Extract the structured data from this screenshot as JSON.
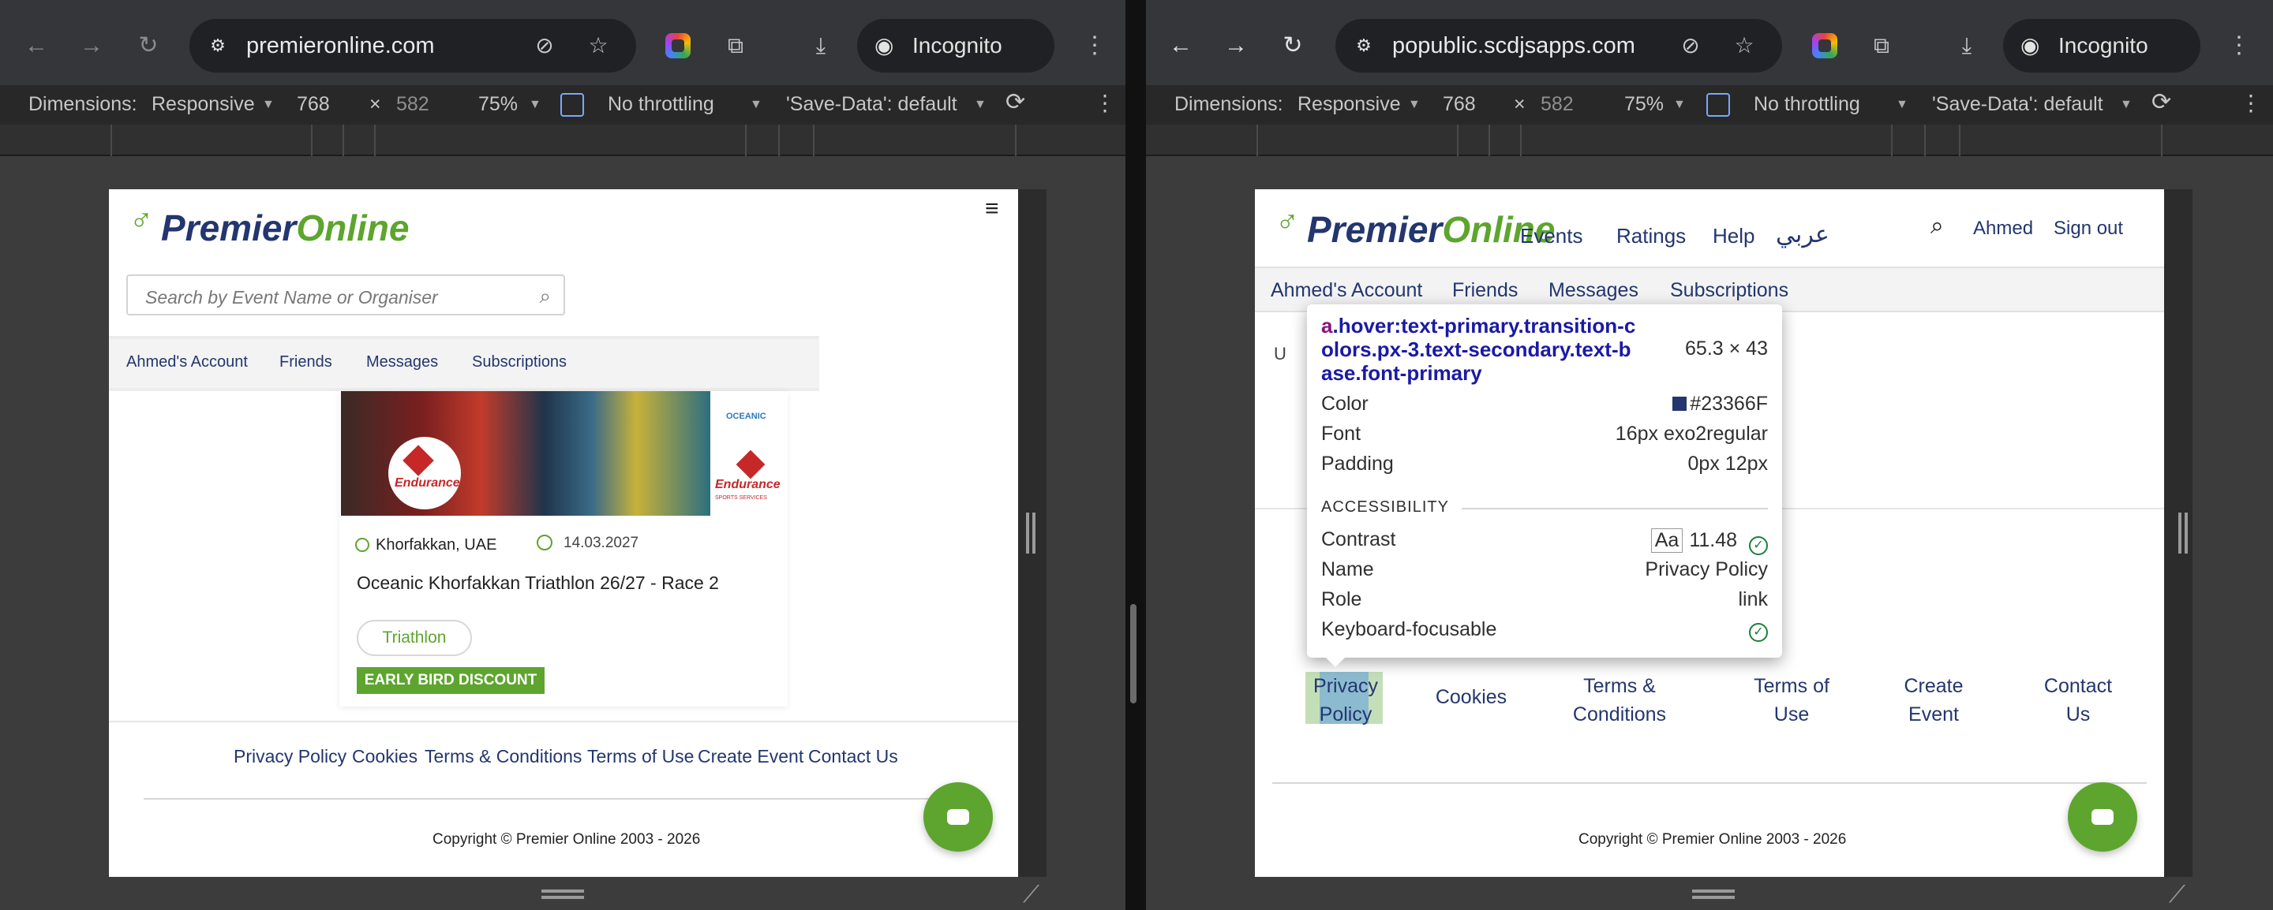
{
  "left": {
    "toolbar": {
      "url": "premieronline.com",
      "incognito": "Incognito (2)"
    },
    "devbar": {
      "dimensions_label": "Dimensions:",
      "mode": "Responsive",
      "width": "768",
      "times": "×",
      "height": "582",
      "zoom": "75%",
      "throttling": "No throttling",
      "save_data": "'Save-Data': default"
    },
    "site": {
      "logo_premier": "Premier",
      "logo_online": "Online",
      "search_placeholder": "Search by Event Name or Organiser",
      "subnav": [
        "Ahmed's Account",
        "Friends",
        "Messages",
        "Subscriptions"
      ],
      "event": {
        "location": "Khorfakkan, UAE",
        "date": "14.03.2027",
        "title": "Oceanic Khorfakkan Triathlon 26/27 - Race 2",
        "sport": "Triathlon",
        "badge": "EARLY BIRD DISCOUNT",
        "logo_text": "Endurance",
        "logo_sub": "SPORTS SERVICES",
        "oceanic": "OCEANIC"
      },
      "footer_links": [
        "Privacy Policy",
        "Cookies",
        "Terms & Conditions",
        "Terms of Use",
        "Create Event",
        "Contact Us"
      ],
      "copyright": "Copyright © Premier Online 2003 - 2026"
    }
  },
  "right": {
    "toolbar": {
      "url": "popublic.scdjsapps.com",
      "incognito": "Incognito (2)"
    },
    "devbar": {
      "dimensions_label": "Dimensions:",
      "mode": "Responsive",
      "width": "768",
      "times": "×",
      "height": "582",
      "zoom": "75%",
      "throttling": "No throttling",
      "save_data": "'Save-Data': default"
    },
    "site": {
      "logo_premier": "Premier",
      "logo_online": "Online",
      "nav": [
        "Events",
        "Ratings",
        "Help"
      ],
      "arabic": "عربي",
      "user": "Ahmed",
      "signout": "Sign out",
      "subnav": [
        "Ahmed's Account",
        "Friends",
        "Messages",
        "Subscriptions"
      ],
      "partial_text": "U",
      "footer_links": [
        [
          "Privacy",
          "Policy"
        ],
        [
          "Cookies"
        ],
        [
          "Terms &",
          "Conditions"
        ],
        [
          "Terms of",
          "Use"
        ],
        [
          "Create",
          "Event"
        ],
        [
          "Contact",
          "Us"
        ]
      ],
      "copyright": "Copyright © Premier Online 2003 - 2026"
    },
    "inspector": {
      "tag": "a",
      "classes": [
        ".hover:text-primary.transition-c",
        "olors.px-3.text-secondary.text-b",
        "ase.font-primary"
      ],
      "size": "65.3 × 43",
      "rows": [
        {
          "k": "Color",
          "v": "#23366F"
        },
        {
          "k": "Font",
          "v": "16px exo2regular"
        },
        {
          "k": "Padding",
          "v": "0px 12px"
        }
      ],
      "accessibility_heading": "ACCESSIBILITY",
      "a11y": [
        {
          "k": "Contrast",
          "aa": "Aa",
          "v": "11.48"
        },
        {
          "k": "Name",
          "v": "Privacy Policy"
        },
        {
          "k": "Role",
          "v": "link"
        },
        {
          "k": "Keyboard-focusable",
          "v": ""
        }
      ]
    }
  },
  "colors": {
    "brand_green": "#5da52e",
    "brand_navy": "#23366f",
    "chrome_bg": "#35363a",
    "devtools_bg": "#282828"
  },
  "icons": [
    "back-arrow-icon",
    "forward-arrow-icon",
    "reload-icon",
    "site-info-icon",
    "eye-off-icon",
    "star-icon",
    "color-extension-icon",
    "puzzle-extensions-icon",
    "download-icon",
    "incognito-icon",
    "kebab-menu-icon",
    "caret-down-icon",
    "inspect-icon",
    "rotate-device-icon",
    "hamburger-menu-icon",
    "search-icon",
    "location-pin-icon",
    "calendar-icon",
    "chat-bubble-icon",
    "check-circle-icon",
    "resize-corner-icon"
  ]
}
